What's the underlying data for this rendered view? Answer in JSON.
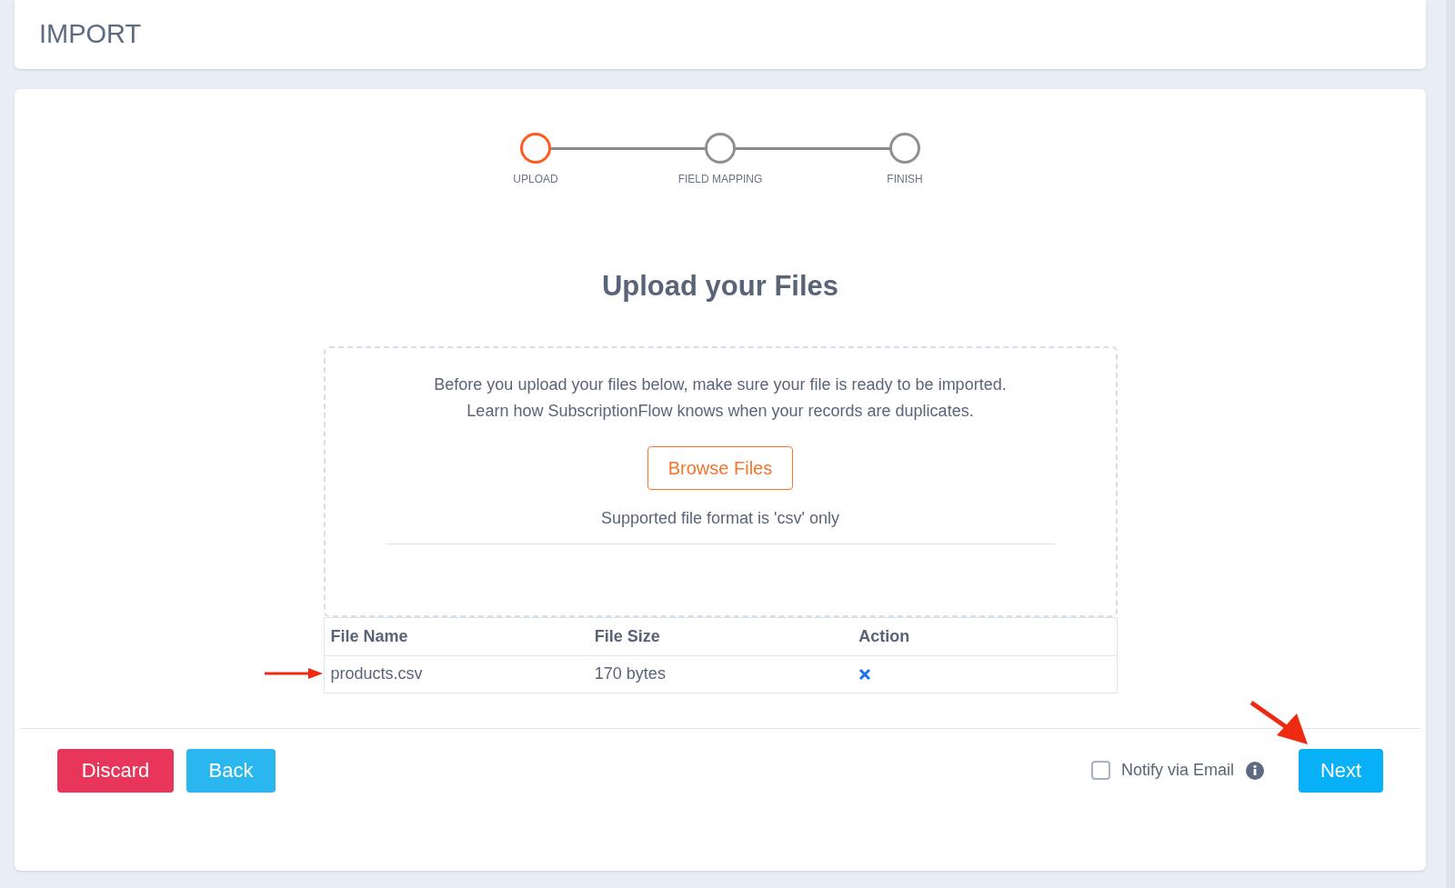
{
  "header": {
    "title": "IMPORT"
  },
  "steps": [
    {
      "label": "UPLOAD",
      "selected": true
    },
    {
      "label": "FIELD MAPPING",
      "selected": false
    },
    {
      "label": "FINISH",
      "selected": false
    }
  ],
  "heading": "Upload your Files",
  "dropzone": {
    "lines": [
      "Before you upload your files below, make sure your file is ready to be imported.",
      "Learn how SubscriptionFlow knows when your records are duplicates."
    ],
    "browse_button": "Browse Files",
    "note": "Supported file format is 'csv' only"
  },
  "table": {
    "columns": [
      "File Name",
      "File Size",
      "Action"
    ],
    "rows": [
      {
        "name": "products.csv",
        "size": "170 bytes"
      }
    ]
  },
  "footer": {
    "discard": "Discard",
    "back": "Back",
    "notify": {
      "label": "Notify via Email",
      "checked": false
    },
    "next": "Next"
  }
}
